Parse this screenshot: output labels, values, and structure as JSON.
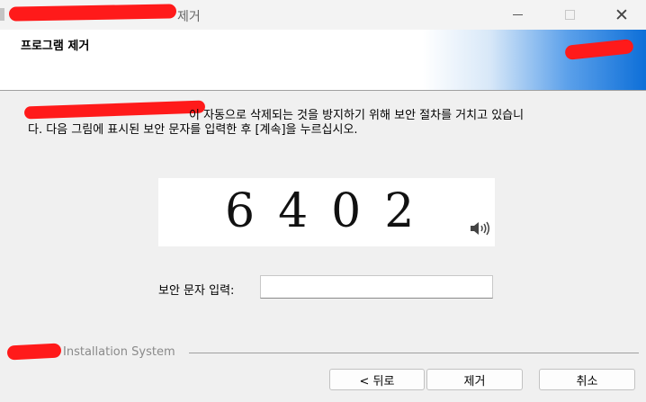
{
  "window": {
    "title_suffix": "제거"
  },
  "header": {
    "title": "프로그램 제거"
  },
  "description": {
    "line1": "이 자동으로 삭제되는 것을 방지하기 위해 보안 절차를 거치고 있습니",
    "line2": "다. 다음 그림에 표시된 보안 문자를 입력한 후 [계속]을 누르십시오."
  },
  "captcha": {
    "code": "6402",
    "audio_icon": "speaker-icon"
  },
  "form": {
    "label": "보안 문자 입력:",
    "value": ""
  },
  "footer": {
    "brand": "Installation System"
  },
  "buttons": {
    "back": "< 뒤로",
    "remove": "제거",
    "cancel": "취소"
  },
  "colors": {
    "header_gradient_end": "#0d6fd8",
    "redaction": "#ff1a1a"
  }
}
